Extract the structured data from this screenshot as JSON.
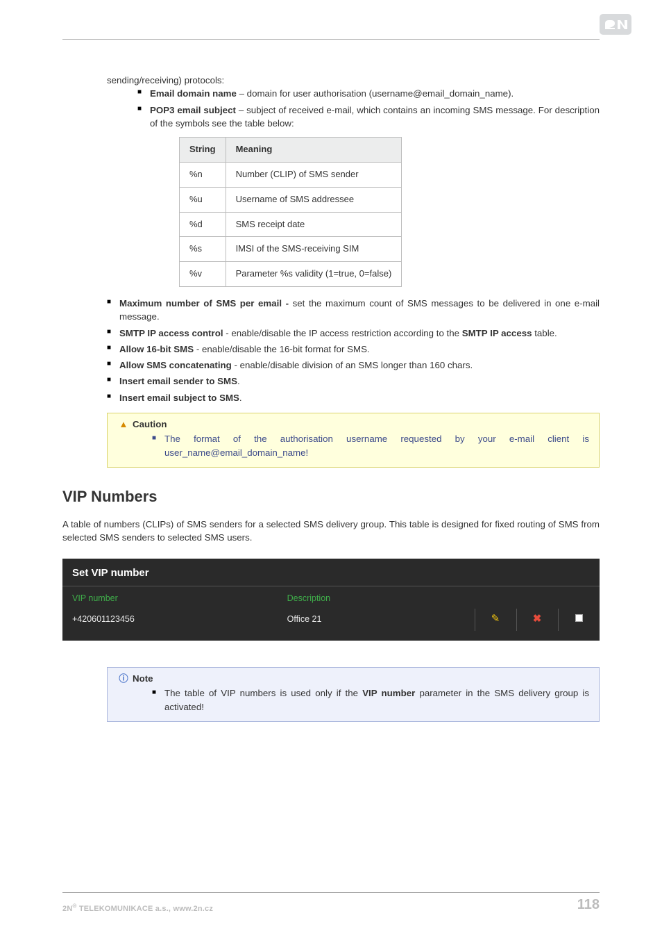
{
  "intro": "sending/receiving) protocols:",
  "bullets_top": [
    {
      "label": "Email domain name",
      "text": " – domain for user authorisation (username@email_domain_name)."
    },
    {
      "label": "POP3 email subject",
      "text": " – subject of received e-mail, which contains an incoming SMS message. For description of the symbols see the table below:"
    }
  ],
  "symtable": {
    "headers": [
      "String",
      "Meaning"
    ],
    "rows": [
      [
        "%n",
        "Number (CLIP) of SMS sender"
      ],
      [
        "%u",
        "Username of SMS addressee"
      ],
      [
        "%d",
        "SMS receipt date"
      ],
      [
        "%s",
        "IMSI of the SMS-receiving SIM"
      ],
      [
        "%v",
        "Parameter %s validity (1=true, 0=false)"
      ]
    ]
  },
  "bullets_mid": [
    {
      "bold": "Maximum number of SMS per email - ",
      "text": "set the maximum count of SMS messages to be delivered in one e-mail message."
    },
    {
      "bold": "SMTP IP access control",
      "mid": " - enable/disable the IP access restriction according to the ",
      "bold2": "SMTP IP access",
      "tail": " table."
    },
    {
      "bold": "Allow 16-bit SMS",
      "text": " - enable/disable the 16-bit format for SMS."
    },
    {
      "bold": "Allow SMS concatenating",
      "text": " - enable/disable division of an SMS longer than 160 chars."
    },
    {
      "bold": "Insert email sender to SMS",
      "text": "."
    },
    {
      "bold": "Insert email subject to SMS",
      "text": "."
    }
  ],
  "caution": {
    "title": "Caution",
    "item": "The format of the authorisation username requested by your e-mail client is user_name@email_domain_name!"
  },
  "section_title": "VIP Numbers",
  "section_text": "A table of numbers (CLIPs) of SMS senders for a selected SMS delivery group. This table is designed for fixed routing of SMS from selected SMS senders to selected SMS users.",
  "vip": {
    "title": "Set VIP number",
    "headers": [
      "VIP number",
      "Description"
    ],
    "row": [
      "+420601123456",
      "Office 21"
    ]
  },
  "note": {
    "title": "Note",
    "pre": "The table of VIP numbers is used only if the ",
    "bold": "VIP number",
    "post": " parameter in the SMS delivery group is activated!"
  },
  "footer": {
    "left_pre": "2N",
    "left_sup": "®",
    "left_post": " TELEKOMUNIKACE a.s., www.2n.cz",
    "page": "118"
  }
}
